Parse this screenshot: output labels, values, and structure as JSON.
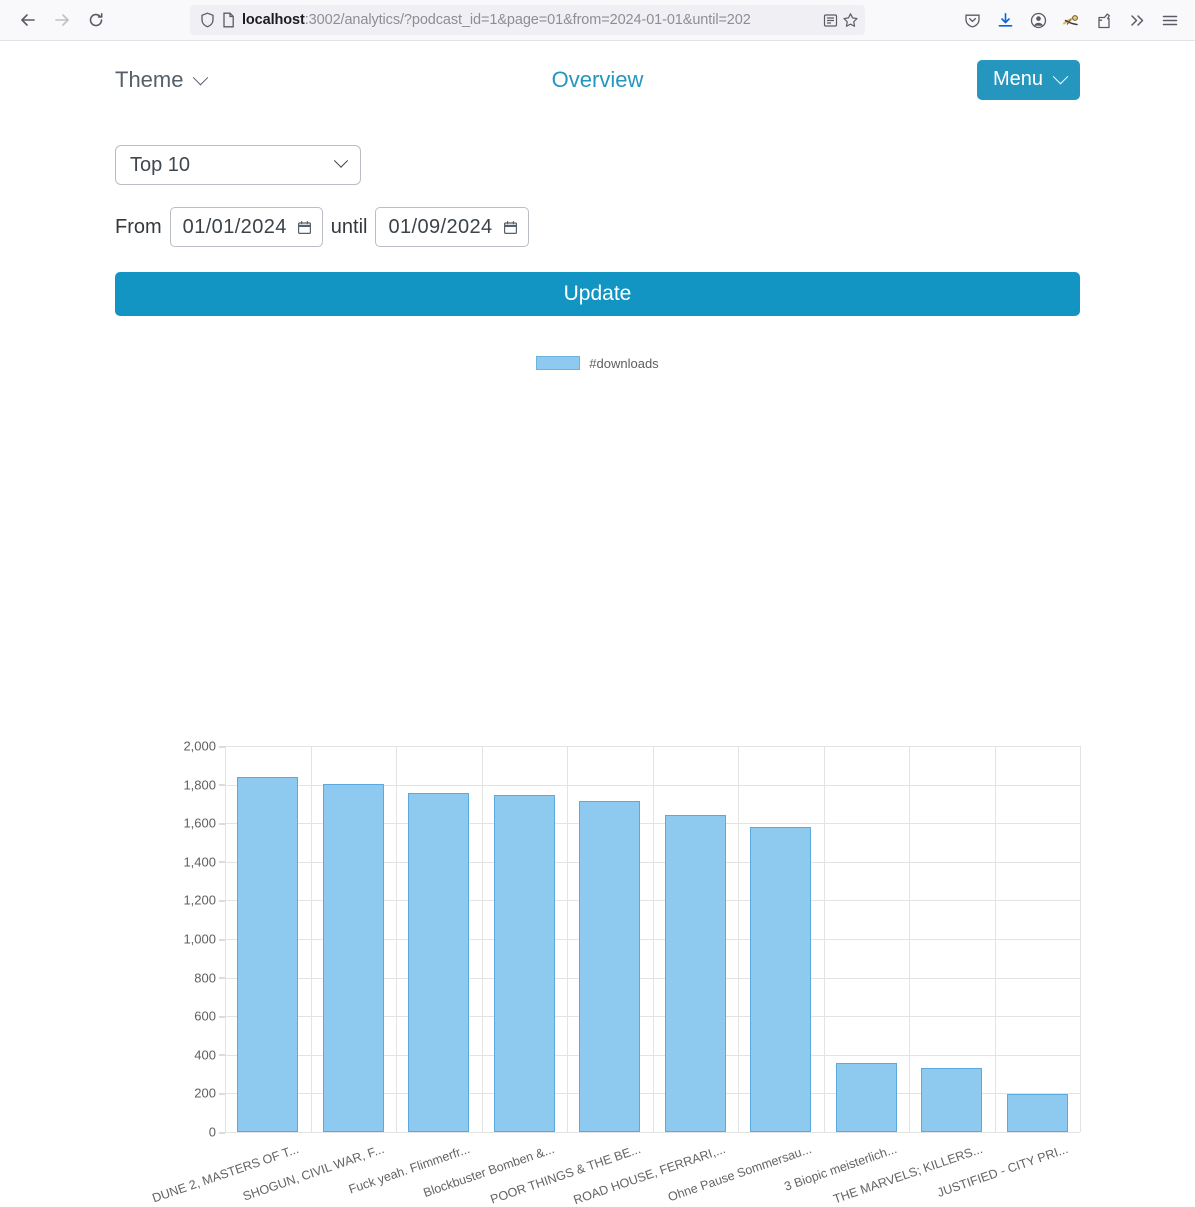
{
  "browser": {
    "back_icon": "back-arrow-icon",
    "forward_icon": "forward-arrow-icon",
    "reload_icon": "reload-icon",
    "shield_icon": "shield-icon",
    "page_icon": "page-info-icon",
    "url_host": "localhost",
    "url_rest": ":3002/analytics/?podcast_id=1&page=01&from=2024-01-01&until=202",
    "reader_icon": "reader-view-icon",
    "bookmark_icon": "bookmark-star-icon",
    "toolbar_icons": [
      "pocket-save-icon",
      "downloads-icon",
      "account-icon",
      "extension-icon",
      "fingerprint-shield-icon",
      "overflow-chevrons-icon",
      "app-menu-hamburger-icon"
    ]
  },
  "header": {
    "theme_label": "Theme",
    "title": "Overview",
    "menu_label": "Menu",
    "accent_color": "#2596be"
  },
  "controls": {
    "top_select_value": "Top 10",
    "from_label": "From",
    "from_value": "01/01/2024",
    "until_label": "until",
    "until_value": "01/09/2024",
    "update_label": "Update",
    "update_color": "#1295c2"
  },
  "chart_data": {
    "type": "bar",
    "title": "",
    "xlabel": "",
    "ylabel": "",
    "legend": [
      "#downloads"
    ],
    "legend_position": "top-center",
    "grid": true,
    "ylim": [
      0,
      2000
    ],
    "yticks": [
      "2,000",
      "1,800",
      "1,600",
      "1,400",
      "1,200",
      "1,000",
      "800",
      "600",
      "400",
      "200",
      "0"
    ],
    "ytick_values": [
      2000,
      1800,
      1600,
      1400,
      1200,
      1000,
      800,
      600,
      400,
      200,
      0
    ],
    "bar_color": "#8ecaf0",
    "bar_border_color": "#5ba9dd",
    "categories": [
      "DUNE 2, MASTERS OF T...",
      "SHOGUN, CIVIL WAR, F...",
      "Fuck yeah. Flimmerfr...",
      "Blockbuster Bomben &...",
      "POOR THINGS & THE BE...",
      "ROAD HOUSE, FERRARI,...",
      "Ohne Pause Sommersau...",
      "3 Biopic meisterlich...",
      "THE MARVELS; KILLERS...",
      "JUSTIFIED - CITY PRI..."
    ],
    "series": [
      {
        "name": "#downloads",
        "values": [
          1840,
          1805,
          1755,
          1745,
          1715,
          1640,
          1580,
          355,
          330,
          195
        ]
      }
    ]
  }
}
